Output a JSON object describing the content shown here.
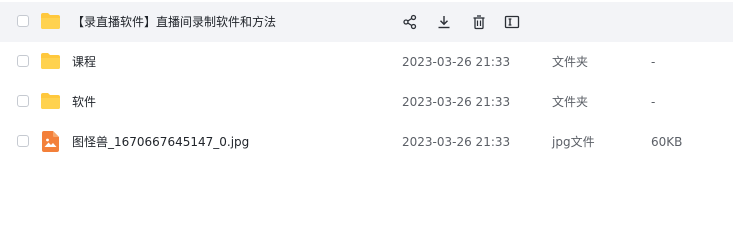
{
  "header": {
    "name": "【录直播软件】直播间录制软件和方法"
  },
  "files": [
    {
      "name": "课程",
      "modified": "2023-03-26 21:33",
      "type": "文件夹",
      "size": "-",
      "icon": "folder-icon"
    },
    {
      "name": "软件",
      "modified": "2023-03-26 21:33",
      "type": "文件夹",
      "size": "-",
      "icon": "folder-icon"
    },
    {
      "name": "图怪兽_1670667645147_0.jpg",
      "modified": "2023-03-26 21:33",
      "type": "jpg文件",
      "size": "60KB",
      "icon": "image-file-icon"
    }
  ],
  "colors": {
    "folder": "#ffc83d",
    "image_file": "#f3803a",
    "header_bg": "#f3f4f7"
  }
}
